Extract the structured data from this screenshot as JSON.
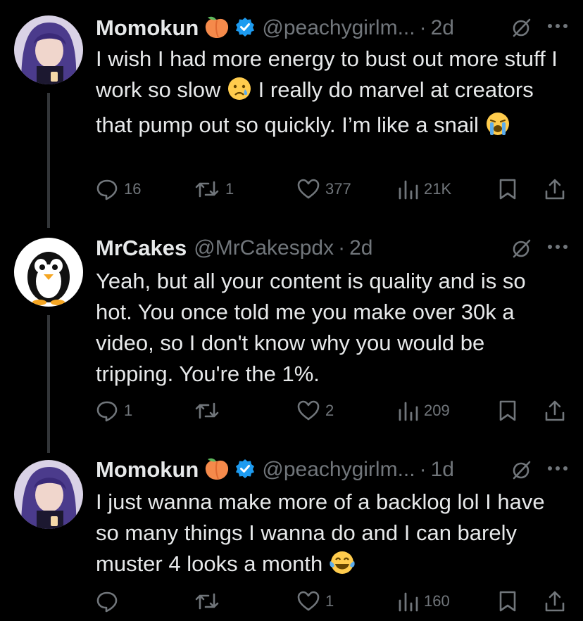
{
  "tweets": [
    {
      "name": "Momokun",
      "handle": "@peachygirlm...",
      "sep": "·",
      "time": "2d",
      "text_parts": [
        "I wish I had more energy to bust out more stuff I work so slow ",
        " I really do marvel at creators that pump out so quickly. I’m like a snail "
      ],
      "replies": "16",
      "retweets": "1",
      "likes": "377",
      "views": "21K",
      "verified": true
    },
    {
      "name": "MrCakes",
      "handle": "@MrCakespdx",
      "sep": "·",
      "time": "2d",
      "text": "Yeah, but all your content is quality and is so hot.  You once told me you make over 30k a video, so I don't know why you would be tripping.  You're the 1%.",
      "replies": "1",
      "retweets": "",
      "likes": "2",
      "views": "209",
      "verified": false
    },
    {
      "name": "Momokun",
      "handle": "@peachygirlm...",
      "sep": "·",
      "time": "1d",
      "text": "I just wanna make more of a backlog lol I have so many things I wanna do and I can barely muster 4 looks a month ",
      "replies": "",
      "retweets": "",
      "likes": "1",
      "views": "160",
      "verified": true
    }
  ],
  "colors": {
    "background": "#000000",
    "text": "#e7e9ea",
    "muted": "#71767b",
    "verified_blue": "#1d9bf0",
    "thread_line": "#333639"
  }
}
